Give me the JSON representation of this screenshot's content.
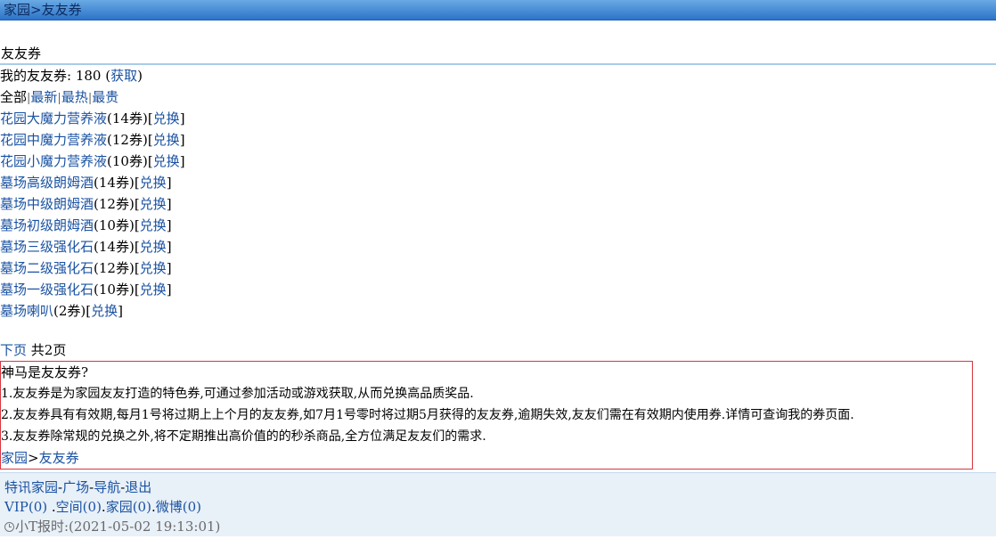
{
  "breadcrumb": {
    "home": "家园",
    "separator": ">",
    "current": "友友券"
  },
  "section_title": "友友券",
  "my_coupons": {
    "label": "我的友友券:",
    "value": "180",
    "get_link": "获取"
  },
  "filters": {
    "all": "全部",
    "newest": "最新",
    "hottest": "最热",
    "priciest": "最贵",
    "sep": "|"
  },
  "items": [
    {
      "name": "花园大魔力营养液",
      "cost": "(14券)",
      "action": "兑换"
    },
    {
      "name": "花园中魔力营养液",
      "cost": "(12券)",
      "action": "兑换"
    },
    {
      "name": "花园小魔力营养液",
      "cost": "(10券)",
      "action": "兑换"
    },
    {
      "name": "墓场高级朗姆酒",
      "cost": "(14券)",
      "action": "兑换"
    },
    {
      "name": "墓场中级朗姆酒",
      "cost": "(12券)",
      "action": "兑换"
    },
    {
      "name": "墓场初级朗姆酒",
      "cost": "(10券)",
      "action": "兑换"
    },
    {
      "name": "墓场三级强化石",
      "cost": "(14券)",
      "action": "兑换"
    },
    {
      "name": "墓场二级强化石",
      "cost": "(12券)",
      "action": "兑换"
    },
    {
      "name": "墓场一级强化石",
      "cost": "(10券)",
      "action": "兑换"
    },
    {
      "name": "墓场喇叭",
      "cost": "(2券)",
      "action": "兑换"
    }
  ],
  "pagination": {
    "next": "下页",
    "total": "共2页"
  },
  "faq": {
    "title": "神马是友友券?",
    "lines": [
      "1.友友券是为家园友友打造的特色券,可通过参加活动或游戏获取,从而兑换高品质奖品.",
      "2.友友券具有有效期,每月1号将过期上上个月的友友券,如7月1号零时将过期5月获得的友友券,逾期失效,友友们需在有效期内使用券.详情可查询我的券页面.",
      "3.友友券除常规的兑换之外,将不定期推出高价值的的秒杀商品,全方位满足友友们的需求."
    ]
  },
  "bottom_breadcrumb": {
    "home": "家园",
    "separator": ">",
    "current": "友友券"
  },
  "footer": {
    "nav": {
      "site": "特讯家园",
      "plaza": "广场",
      "guide": "导航",
      "logout": "退出",
      "dash": "-"
    },
    "stats": {
      "vip": "VIP(0)",
      "space": "空间(0)",
      "home": "家园(0)",
      "weibo": "微博(0)",
      "dot": "."
    },
    "time": {
      "icon": "clock-icon",
      "text": "小T报时:(2021-05-02 19:13:01)"
    }
  }
}
